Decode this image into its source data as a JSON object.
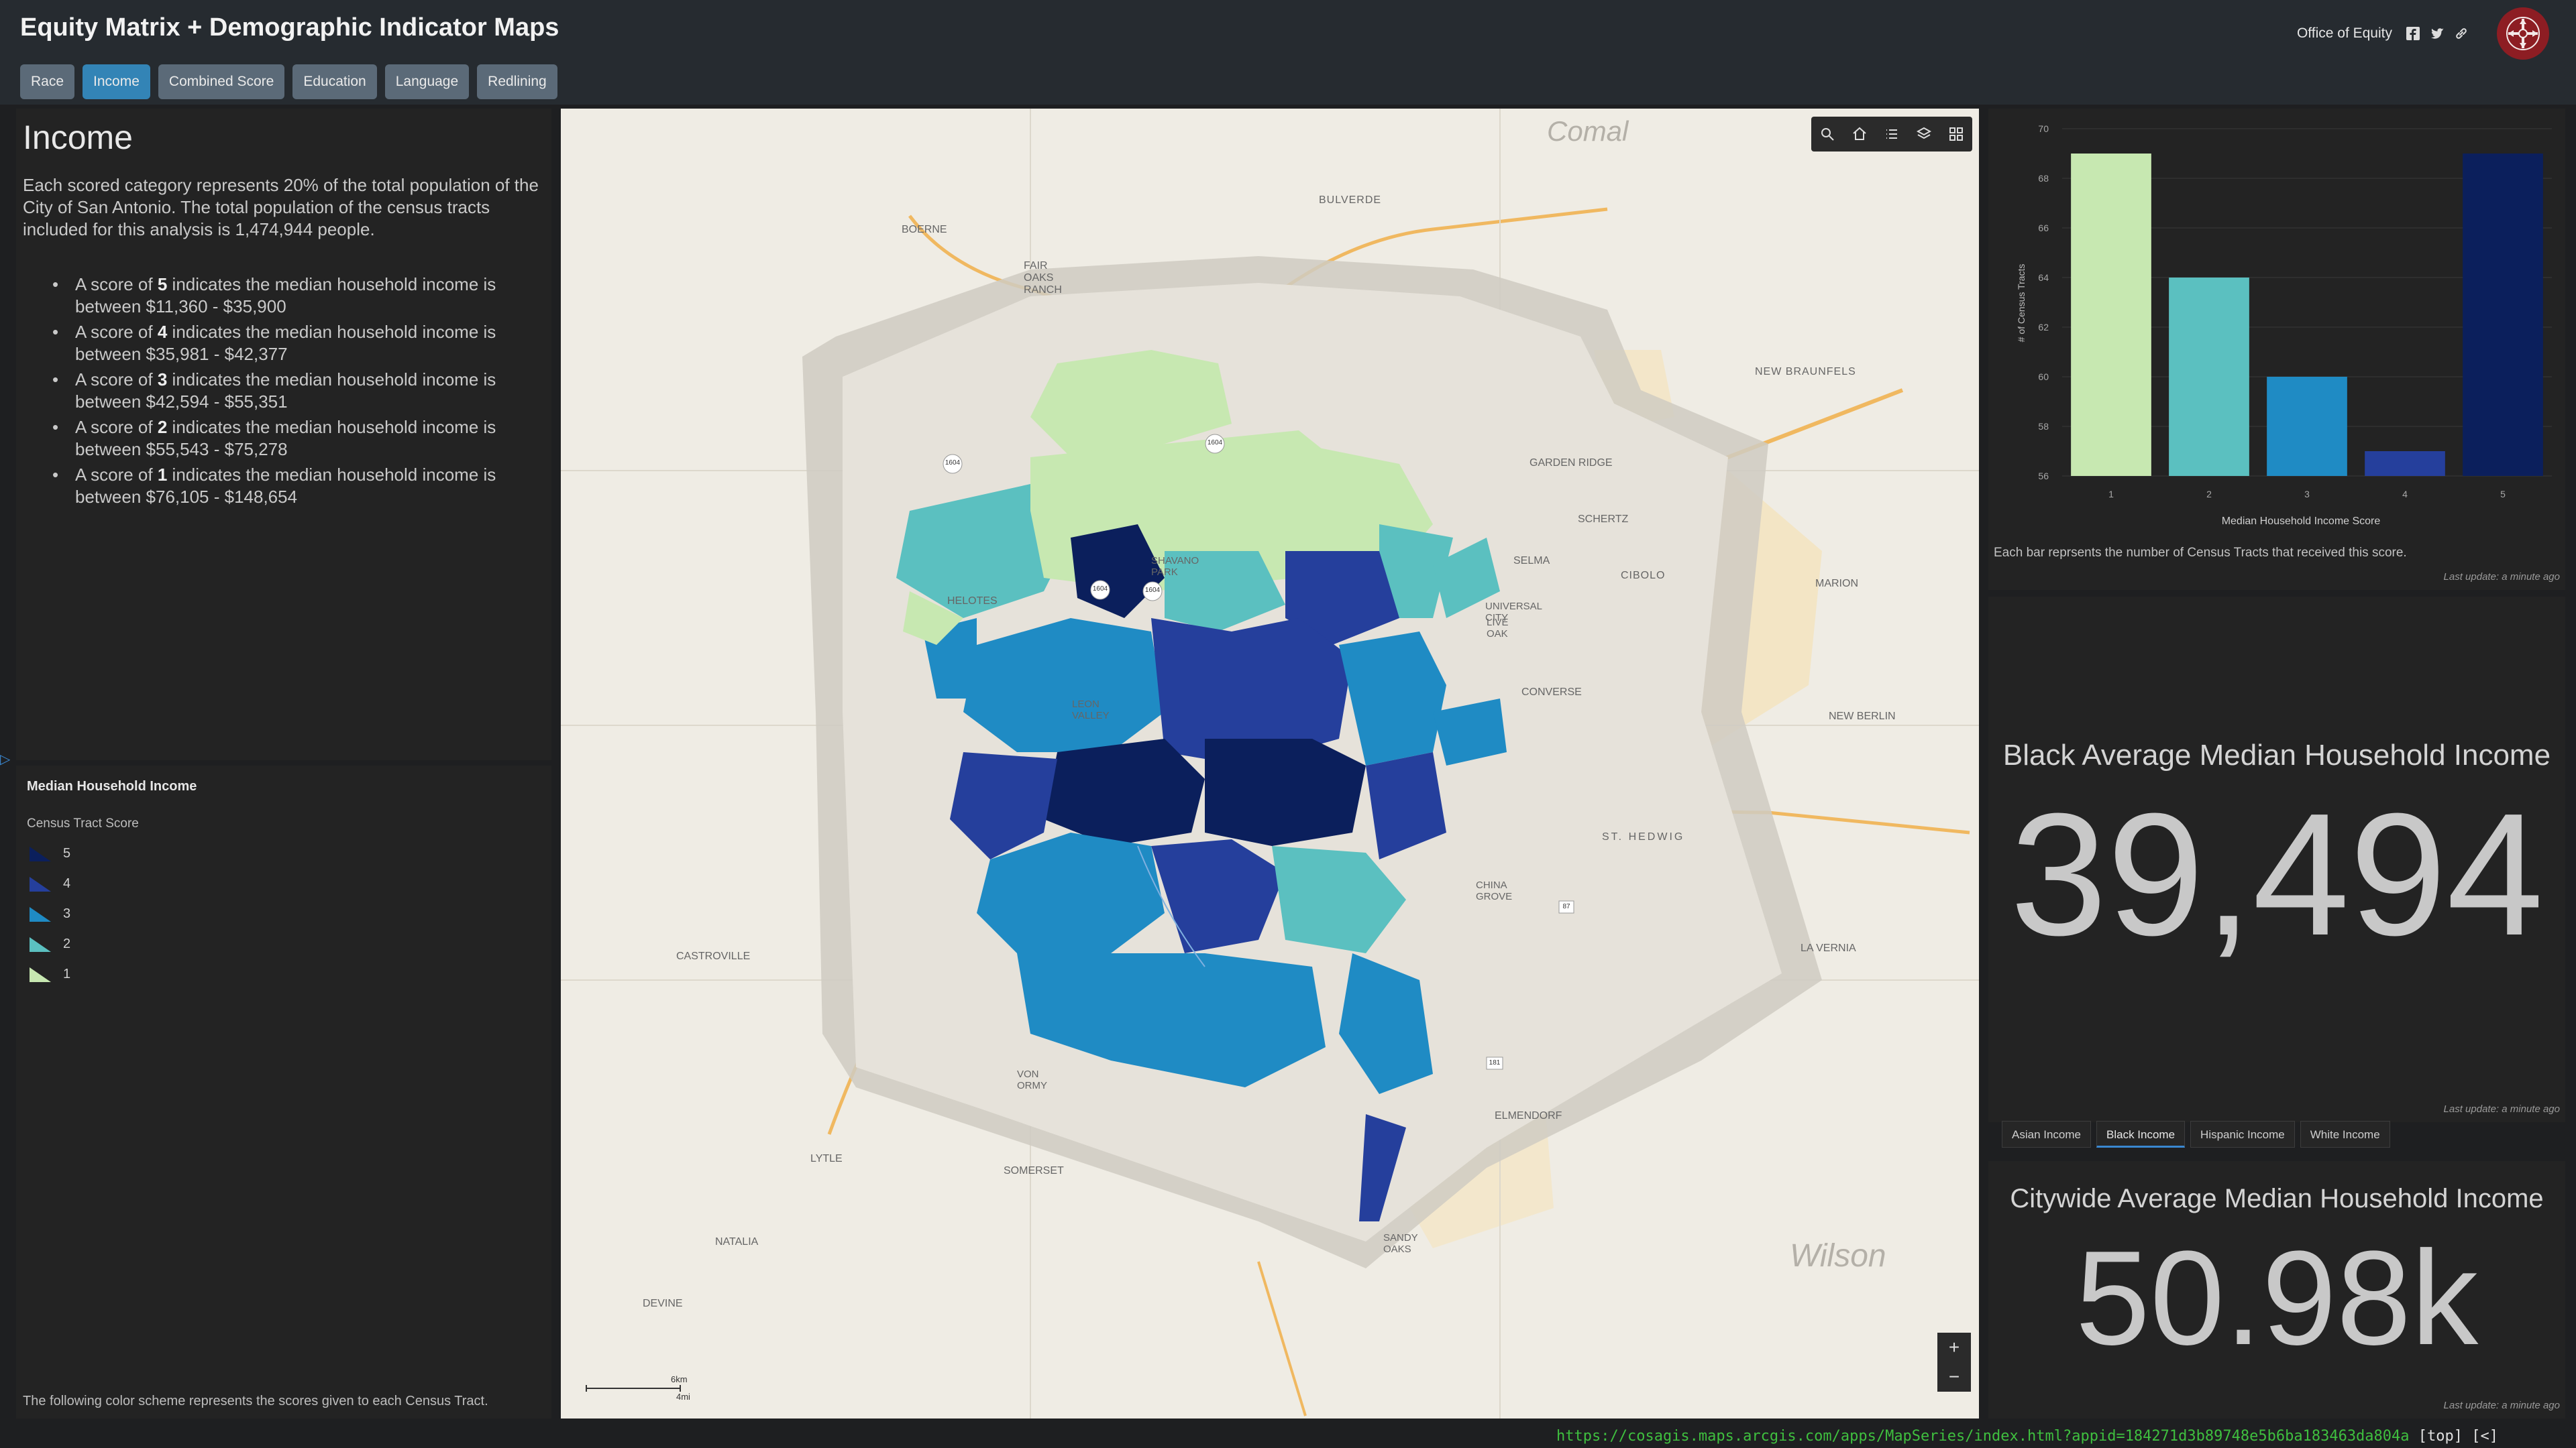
{
  "app": {
    "title": "Equity Matrix + Demographic Indicator Maps",
    "office_link": "Office of Equity",
    "tabs": [
      {
        "label": "Race",
        "active": false
      },
      {
        "label": "Income",
        "active": true
      },
      {
        "label": "Combined Score",
        "active": false
      },
      {
        "label": "Education",
        "active": false
      },
      {
        "label": "Language",
        "active": false
      },
      {
        "label": "Redlining",
        "active": false
      }
    ]
  },
  "info": {
    "title": "Income",
    "description": "Each scored category represents 20% of the total population of the City of San Antonio. The total population of the census tracts included for this analysis is 1,474,944 people.",
    "items": [
      {
        "pre": "A score of ",
        "score": "5",
        "post": " indicates the median household income is between $11,360 - $35,900"
      },
      {
        "pre": "A score of ",
        "score": "4",
        "post": " indicates the median household income is between $35,981 - $42,377"
      },
      {
        "pre": "A score of ",
        "score": "3",
        "post": " indicates the median household income is between $42,594 - $55,351"
      },
      {
        "pre": "A score of ",
        "score": "2",
        "post": " indicates the median household income is between $55,543 - $75,278"
      },
      {
        "pre": "A score of ",
        "score": "1",
        "post": " indicates the median household income is between $76,105 - $148,654"
      }
    ]
  },
  "legend": {
    "title": "Median Household Income",
    "subtitle": "Census Tract Score",
    "entries": [
      {
        "label": "5",
        "color": "#0b1f5c"
      },
      {
        "label": "4",
        "color": "#253f9c"
      },
      {
        "label": "3",
        "color": "#1f8bc4"
      },
      {
        "label": "2",
        "color": "#5bc0c0"
      },
      {
        "label": "1",
        "color": "#c7e8b1"
      }
    ],
    "footer": "The following color scheme represents the scores given to each Census Tract."
  },
  "map": {
    "places": [
      "Comal",
      "BULVERDE",
      "BOERNE",
      "FAIR OAKS RANCH",
      "NEW BRAUNFELS",
      "GARDEN RIDGE",
      "SCHERTZ",
      "SELMA",
      "CIBOLO",
      "MARION",
      "UNIVERSAL CITY",
      "LIVE OAK",
      "CONVERSE",
      "NEW BERLIN",
      "HELOTES",
      "SHAVANO PARK",
      "LEON VALLEY",
      "ST. HEDWIG",
      "CHINA GROVE",
      "LA VERNIA",
      "CASTROVILLE",
      "ELMENDORF",
      "VON ORMY",
      "SOMERSET",
      "LYTLE",
      "SANDY OAKS",
      "NATALIA",
      "DEVINE",
      "Wilson"
    ],
    "shields": [
      "1604",
      "1604",
      "1604",
      "1604",
      "181",
      "87"
    ],
    "scale_km": "6km",
    "scale_mi": "4mi",
    "zoom_in": "+",
    "zoom_out": "−",
    "tools": [
      "search-icon",
      "home-icon",
      "list-icon",
      "layers-icon",
      "basemap-icon"
    ]
  },
  "chart_panel": {
    "caption": "Each bar reprsents the number of Census Tracts that received this score.",
    "last_update": "Last update: a minute ago"
  },
  "chart_data": {
    "type": "bar",
    "categories": [
      "1",
      "2",
      "3",
      "4",
      "5"
    ],
    "values": [
      69,
      64,
      60,
      57,
      69
    ],
    "colors": [
      "#c7e8b1",
      "#5bc0c0",
      "#1f8bc4",
      "#253f9c",
      "#0b1f5c"
    ],
    "xlabel": "Median Household Income Score",
    "ylabel": "# of Census Tracts",
    "ylim": [
      56,
      70
    ],
    "yticks": [
      56,
      58,
      60,
      62,
      64,
      66,
      68,
      70
    ],
    "grid": true
  },
  "black_income": {
    "title": "Black Average Median Household Income",
    "value": "39,494",
    "last_update": "Last update: a minute ago"
  },
  "income_tabs": [
    {
      "label": "Asian Income",
      "active": false
    },
    {
      "label": "Black Income",
      "active": true
    },
    {
      "label": "Hispanic Income",
      "active": false
    },
    {
      "label": "White Income",
      "active": false
    }
  ],
  "citywide": {
    "title": "Citywide Average Median Household Income",
    "value": "50.98k",
    "last_update": "Last update: a minute ago"
  },
  "url_bar": {
    "url": "https://cosagis.maps.arcgis.com/apps/MapSeries/index.html?appid=184271d3b89748e5b6ba183463da804a",
    "suffix": " [top] [<]"
  }
}
